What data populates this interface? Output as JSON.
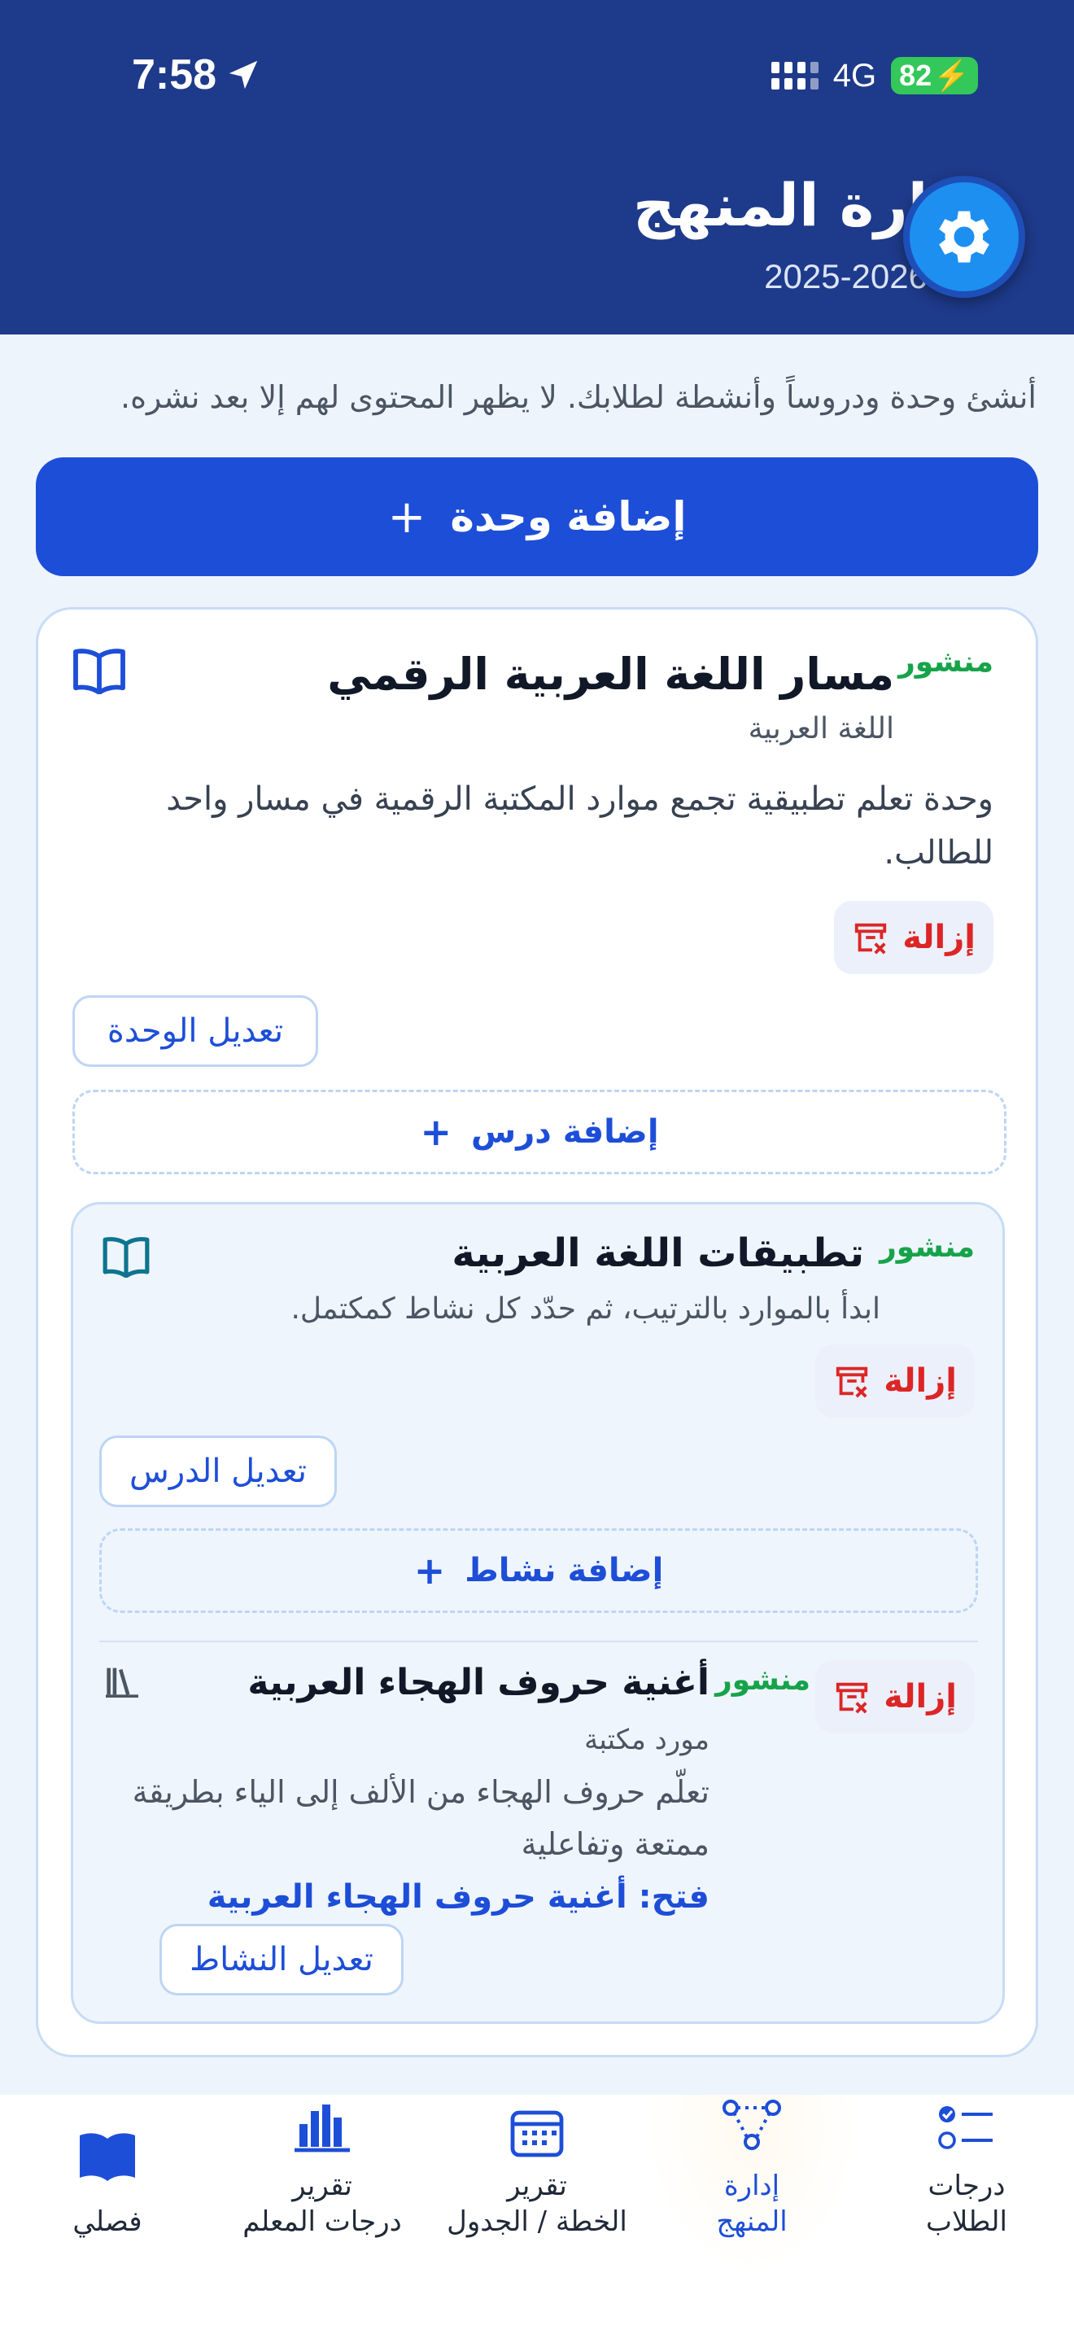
{
  "status_bar": {
    "time": "7:58",
    "network": "4G",
    "battery": "82"
  },
  "header": {
    "title": "إدارة المنهج",
    "year": "2025-2026"
  },
  "intro_text": "أنشئ وحدة ودروساً وأنشطة لطلابك. لا يظهر المحتوى لهم إلا بعد نشره.",
  "add_unit_label": "إضافة وحدة",
  "plus_symbol": "+",
  "unit": {
    "status": "منشور",
    "title": "مسار اللغة العربية الرقمي",
    "subject": "اللغة العربية",
    "description": "وحدة تعلم تطبيقية تجمع موارد المكتبة الرقمية في مسار واحد للطالب.",
    "remove_label": "إزالة",
    "edit_label": "تعديل الوحدة",
    "add_lesson_label": "إضافة درس"
  },
  "lesson": {
    "status": "منشور",
    "title": "تطبيقات اللغة العربية",
    "description": "ابدأ بالموارد بالترتيب، ثم حدّد كل نشاط كمكتمل.",
    "remove_label": "إزالة",
    "edit_label": "تعديل الدرس",
    "add_activity_label": "إضافة نشاط"
  },
  "activity": {
    "status": "منشور",
    "title": "أغنية حروف الهجاء العربية",
    "type": "مورد مكتبة",
    "description": "تعلّم حروف الهجاء من الألف إلى الياء بطريقة ممتعة وتفاعلية",
    "open_label": "فتح: أغنية حروف الهجاء العربية",
    "remove_label": "إزالة",
    "edit_label": "تعديل النشاط"
  },
  "bottom_nav": [
    {
      "label_line1": "درجات",
      "label_line2": "الطلاب",
      "icon": "checklist-icon"
    },
    {
      "label_line1": "إدارة",
      "label_line2": "المنهج",
      "icon": "hierarchy-icon",
      "active": true
    },
    {
      "label_line1": "تقرير",
      "label_line2": "الخطة / الجدول",
      "icon": "calendar-icon"
    },
    {
      "label_line1": "تقرير",
      "label_line2": "درجات المعلم",
      "icon": "bar-chart-icon"
    },
    {
      "label_line1": "فصلي",
      "label_line2": "",
      "icon": "open-book-icon"
    }
  ],
  "colors": {
    "header_bg": "#1e3a8a",
    "primary": "#1d4ed8",
    "published": "#16a34a",
    "danger": "#dc2626",
    "page_bg": "#eef4fc"
  }
}
